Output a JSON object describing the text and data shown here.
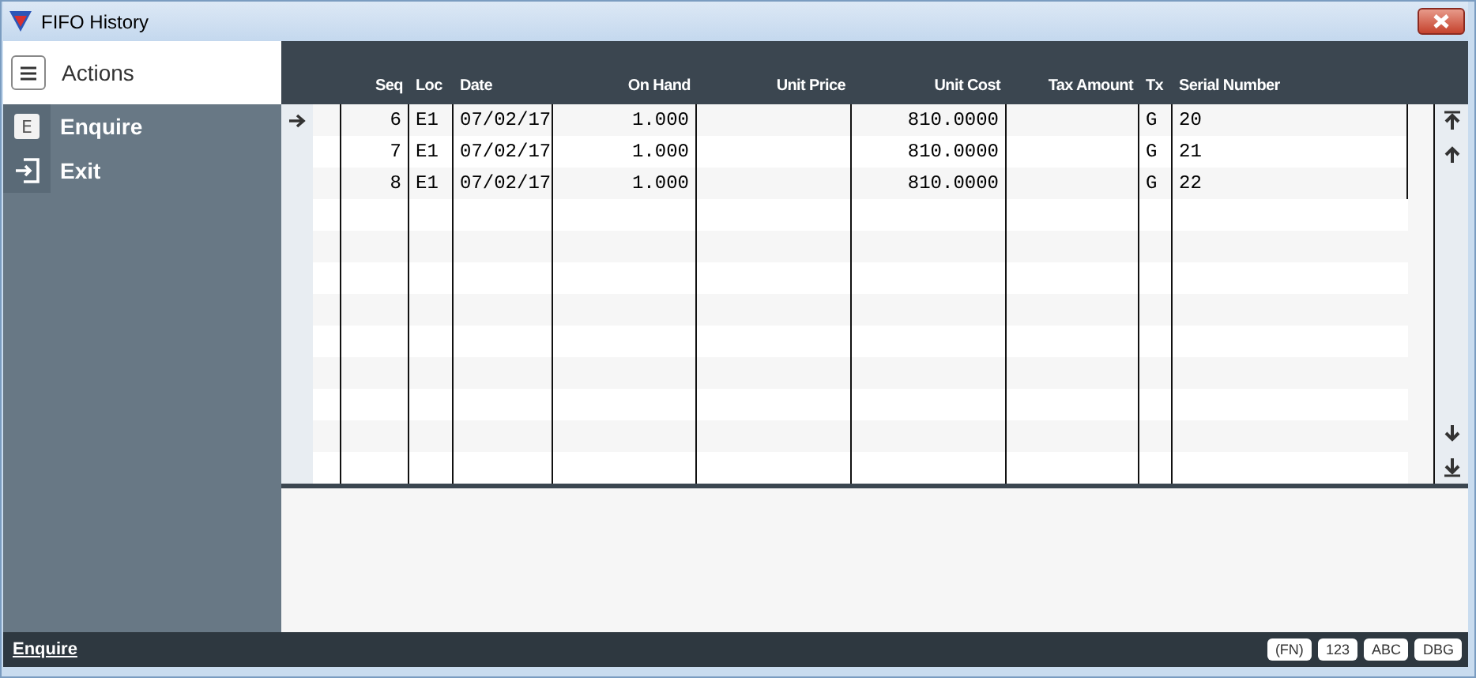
{
  "window": {
    "title": "FIFO History"
  },
  "sidebar": {
    "header": "Actions",
    "items": [
      {
        "kind": "letter",
        "glyph": "E",
        "label": "Enquire"
      },
      {
        "kind": "exit",
        "label": "Exit"
      }
    ]
  },
  "table": {
    "columns": [
      {
        "label": "Seq"
      },
      {
        "label": "Loc"
      },
      {
        "label": "Date"
      },
      {
        "label": "On Hand"
      },
      {
        "label": "Unit Price"
      },
      {
        "label": "Unit Cost"
      },
      {
        "label": "Tax Amount"
      },
      {
        "label": "Tx"
      },
      {
        "label": "Serial Number"
      }
    ],
    "rows": [
      {
        "selected": true,
        "cells": [
          "6",
          "E1",
          "07/02/17",
          "1.000",
          "",
          "810.0000",
          "",
          "G",
          "20"
        ]
      },
      {
        "selected": false,
        "cells": [
          "7",
          "E1",
          "07/02/17",
          "1.000",
          "",
          "810.0000",
          "",
          "G",
          "21"
        ]
      },
      {
        "selected": false,
        "cells": [
          "8",
          "E1",
          "07/02/17",
          "1.000",
          "",
          "810.0000",
          "",
          "G",
          "22"
        ]
      }
    ]
  },
  "status_bar": {
    "text": "Enquire",
    "badges": [
      "(FN)",
      "123",
      "ABC",
      "DBG"
    ]
  }
}
